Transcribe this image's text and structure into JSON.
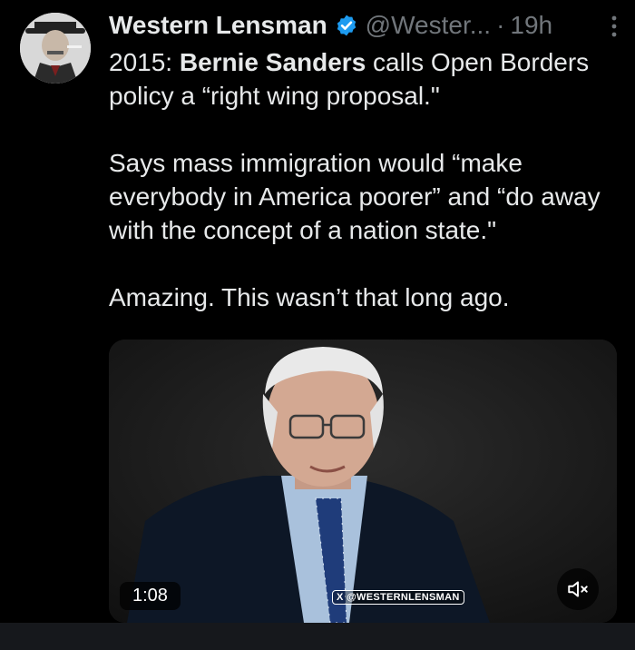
{
  "author": {
    "name": "Western Lensman",
    "handle": "@Wester...",
    "separator": "·",
    "time": "19h"
  },
  "tweet": {
    "line1_prefix": "2015: ",
    "line1_bold": "Bernie Sanders",
    "line1_suffix": " calls Open Borders policy a “right wing proposal.\"",
    "paragraph2": "Says mass immigration would “make everybody in America poorer” and “do away with the concept of a nation state.\"",
    "paragraph3": "Amazing. This wasn’t that long ago."
  },
  "video": {
    "duration": "1:08",
    "watermark": "X @WESTERNLENSMAN"
  },
  "icons": {
    "verified": "verified-badge-icon",
    "more": "more-options-icon",
    "mute": "muted-speaker-icon"
  },
  "colors": {
    "background": "#000000",
    "text": "#e7e9ea",
    "secondary": "#71767b",
    "verified": "#1d9bf0"
  }
}
